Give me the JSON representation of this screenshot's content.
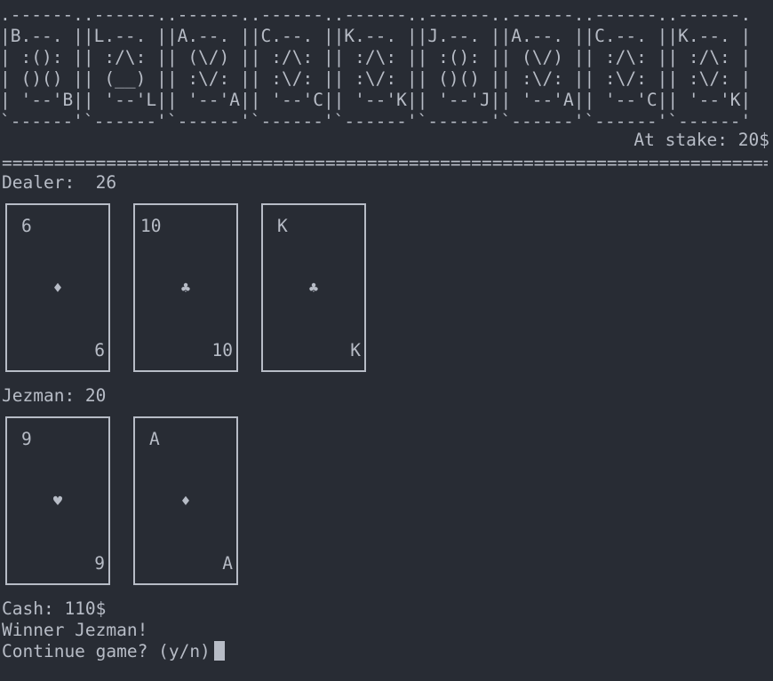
{
  "banner": {
    "ascii": ".------..------..------..------..------..------..------..------..------.\n|B.--. ||L.--. ||A.--. ||C.--. ||K.--. ||J.--. ||A.--. ||C.--. ||K.--. |\n| :(): || :/\\: || (\\/) || :/\\: || :/\\: || :(): || (\\/) || :/\\: || :/\\: |\n| ()() || (__) || :\\/: || :\\/: || :\\/: || ()() || :\\/: || :\\/: || :\\/: |\n| '--'B|| '--'L|| '--'A|| '--'C|| '--'K|| '--'J|| '--'A|| '--'C|| '--'K|\n`------'`------'`------'`------'`------'`------'`------'`------'`------'"
  },
  "stake": "At stake: 20$",
  "divider": "==========================================================================",
  "dealer": {
    "label": "Dealer:  26",
    "cards": [
      {
        "rank": "6",
        "suit": "♦"
      },
      {
        "rank": "10",
        "suit": "♣"
      },
      {
        "rank": "K",
        "suit": "♣"
      }
    ]
  },
  "player": {
    "label": "Jezman: 20",
    "cards": [
      {
        "rank": "9",
        "suit": "♥"
      },
      {
        "rank": "A",
        "suit": "♦"
      }
    ]
  },
  "status": {
    "cash": "Cash: 110$",
    "winner": "Winner Jezman!",
    "prompt": "Continue game? (y/n)"
  }
}
